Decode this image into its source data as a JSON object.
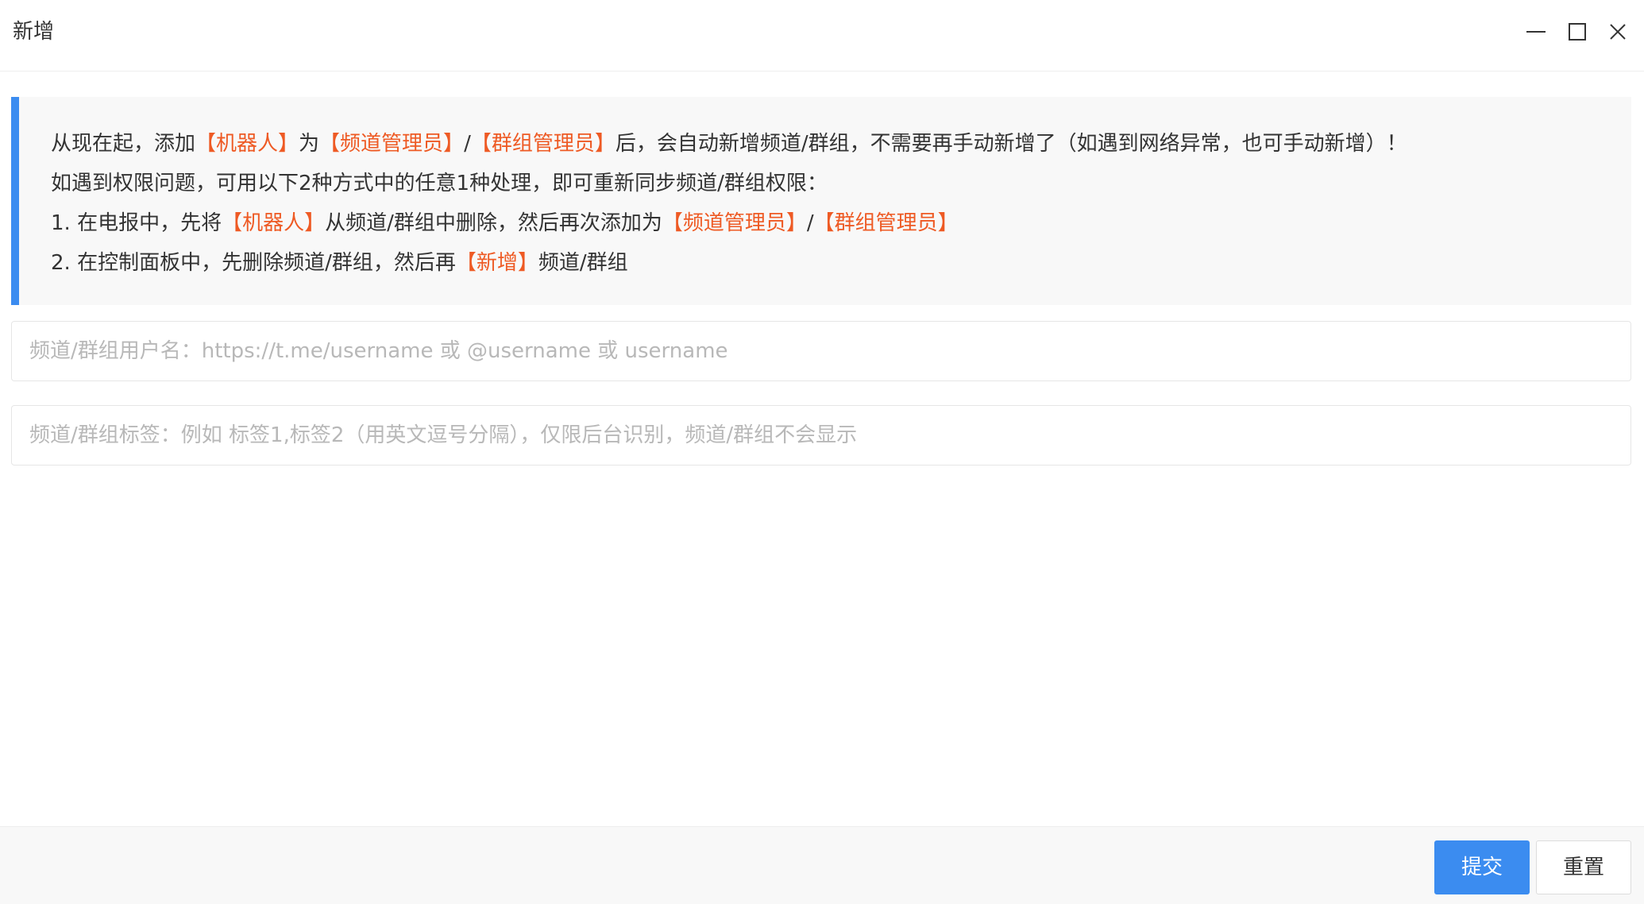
{
  "window": {
    "title": "新增",
    "controls": {
      "minimize_icon": "minimize-icon",
      "maximize_icon": "maximize-icon",
      "close_icon": "close-icon"
    }
  },
  "notice": {
    "line1": {
      "t1": "从现在起，添加",
      "h1": "【机器人】",
      "t2": "为",
      "h2": "【频道管理员】",
      "t3": "/",
      "h3": "【群组管理员】",
      "t4": "后，会自动新增频道/群组，不需要再手动新增了（如遇到网络异常，也可手动新增）！"
    },
    "line2": {
      "t1": "如遇到权限问题，可用以下2种方式中的任意1种处理，即可重新同步频道/群组权限："
    },
    "line3": {
      "t1": "1. 在电报中，先将",
      "h1": "【机器人】",
      "t2": "从频道/群组中删除，然后再次添加为",
      "h2": "【频道管理员】",
      "t3": "/",
      "h3": "【群组管理员】"
    },
    "line4": {
      "t1": "2. 在控制面板中，先删除频道/群组，然后再",
      "h1": "【新增】",
      "t2": "频道/群组"
    }
  },
  "form": {
    "username": {
      "value": "",
      "placeholder": "频道/群组用户名：https://t.me/username 或 @username 或 username"
    },
    "tags": {
      "value": "",
      "placeholder": "频道/群组标签：例如 标签1,标签2（用英文逗号分隔），仅限后台识别，频道/群组不会显示"
    }
  },
  "footer": {
    "submit_label": "提交",
    "reset_label": "重置"
  },
  "colors": {
    "accent": "#3b8cf0",
    "highlight": "#ee5a24",
    "notice_bg": "#f8f8f8"
  }
}
